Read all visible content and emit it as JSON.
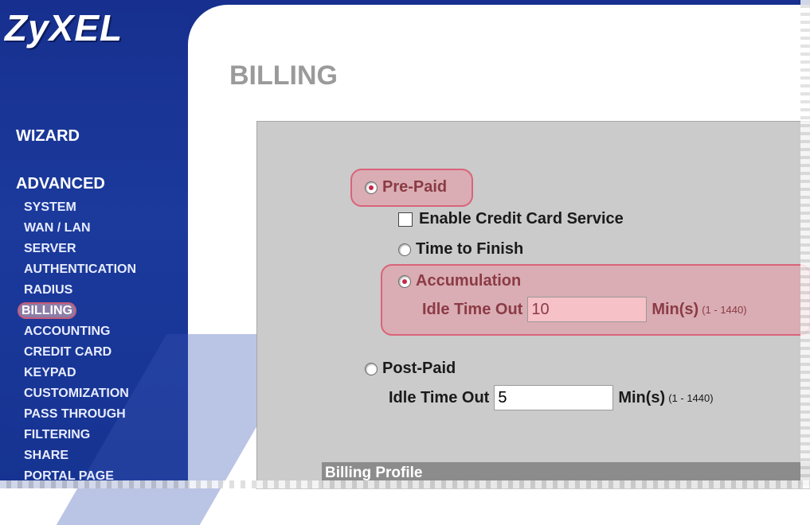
{
  "brand": {
    "logo": "ZyXEL"
  },
  "sidebar": {
    "wizard": "WIZARD",
    "advanced": "ADVANCED",
    "items": [
      {
        "label": "SYSTEM"
      },
      {
        "label": "WAN / LAN"
      },
      {
        "label": "SERVER"
      },
      {
        "label": "AUTHENTICATION"
      },
      {
        "label": "RADIUS"
      },
      {
        "label": "BILLING",
        "active": true
      },
      {
        "label": "ACCOUNTING"
      },
      {
        "label": "CREDIT CARD"
      },
      {
        "label": "KEYPAD"
      },
      {
        "label": "CUSTOMIZATION"
      },
      {
        "label": "PASS THROUGH"
      },
      {
        "label": "FILTERING"
      },
      {
        "label": "SHARE"
      },
      {
        "label": "PORTAL PAGE"
      }
    ]
  },
  "page": {
    "title": "BILLING"
  },
  "billing": {
    "prepaid_label": "Pre-Paid",
    "credit_card_label": "Enable Credit Card Service",
    "time_to_finish_label": "Time to Finish",
    "accumulation_label": "Accumulation",
    "prepaid_idle_label": "Idle Time Out",
    "prepaid_idle_value": "10",
    "postpaid_label": "Post-Paid",
    "postpaid_idle_label": "Idle Time Out",
    "postpaid_idle_value": "5",
    "unit_label": "Min(s)",
    "range_label": "(1 - 1440)",
    "selected_mode": "Pre-Paid",
    "selected_prepaid_mode": "Accumulation",
    "credit_card_enabled": false
  },
  "footer": {
    "section_label": "Billing Profile"
  },
  "colors": {
    "sidebar": "#17308f",
    "highlight": "#d9647a",
    "panel": "#cbcbcb"
  }
}
